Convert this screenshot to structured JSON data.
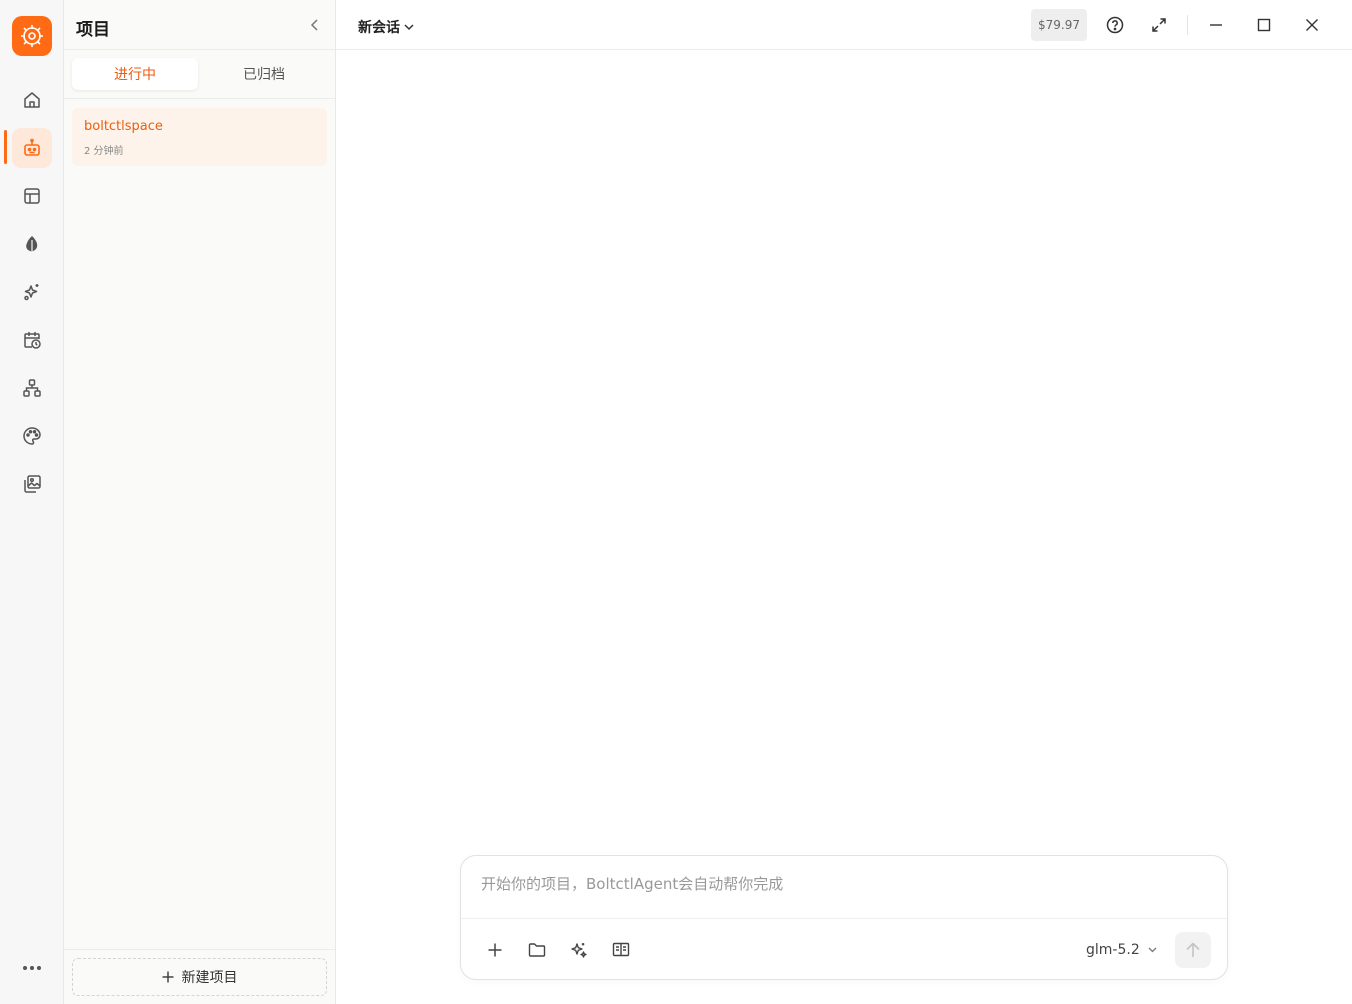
{
  "rail": {
    "logo_icon": "app-logo-icon",
    "items": [
      {
        "name": "home-icon",
        "active": false
      },
      {
        "name": "robot-icon",
        "active": true
      },
      {
        "name": "layout-icon",
        "active": false
      },
      {
        "name": "leaf-icon",
        "active": false
      },
      {
        "name": "sparkles-icon",
        "active": false
      },
      {
        "name": "calendar-clock-icon",
        "active": false
      },
      {
        "name": "hierarchy-icon",
        "active": false
      },
      {
        "name": "palette-icon",
        "active": false
      },
      {
        "name": "gallery-icon",
        "active": false
      }
    ],
    "more_icon": "more-icon"
  },
  "panel": {
    "title": "项目",
    "tabs": [
      {
        "label": "进行中",
        "active": true
      },
      {
        "label": "已归档",
        "active": false
      }
    ],
    "projects": [
      {
        "name": "boltctlspace",
        "time": "2 分钟前"
      }
    ],
    "new_project_label": "新建项目"
  },
  "topbar": {
    "session_title": "新会话",
    "cost": "$79.97"
  },
  "composer": {
    "placeholder": "开始你的项目，BoltctlAgent会自动帮你完成",
    "model": "glm-5.2"
  },
  "colors": {
    "accent": "#ff6a14",
    "accent_text": "#e8600f",
    "active_bg": "#fde8d9"
  }
}
